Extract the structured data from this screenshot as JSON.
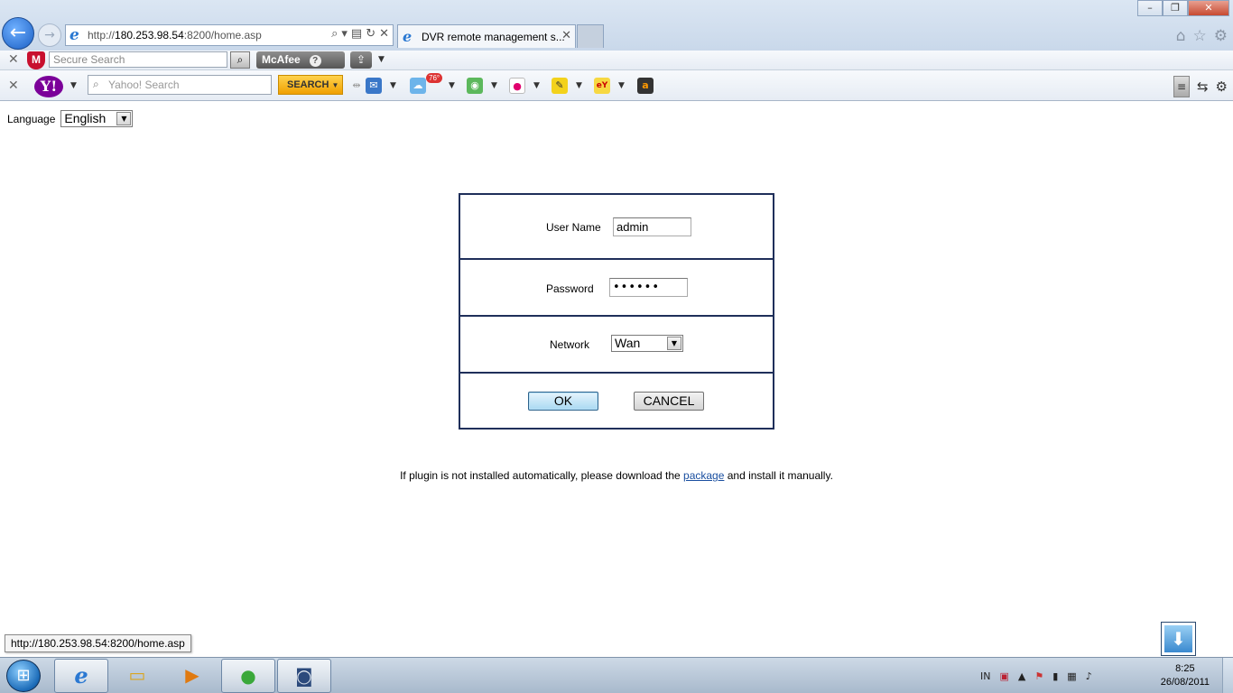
{
  "browser": {
    "address_prefix": "http://",
    "address_host": "180.253.98.54",
    "address_rest": ":8200/home.asp",
    "tab_title": "DVR remote management s...",
    "mcafee_search_placeholder": "Secure Search",
    "mcafee_label": "McAfee",
    "yahoo_search_placeholder": "Yahoo! Search",
    "yahoo_search_button": "SEARCH",
    "weather_temp": "76°"
  },
  "page": {
    "language_label": "Language",
    "language_value": "English",
    "login": {
      "username_label": "User Name",
      "username_value": "admin",
      "password_label": "Password",
      "password_value": "••••••",
      "network_label": "Network",
      "network_value": "Wan",
      "ok_label": "OK",
      "cancel_label": "CANCEL"
    },
    "hint_before": "If plugin is not installed automatically, please download the ",
    "hint_link": "package",
    "hint_after": " and install it manually."
  },
  "status": {
    "url": "http://180.253.98.54:8200/home.asp"
  },
  "taskbar": {
    "language": "IN",
    "time": "8:25",
    "date": "26/08/2011"
  }
}
